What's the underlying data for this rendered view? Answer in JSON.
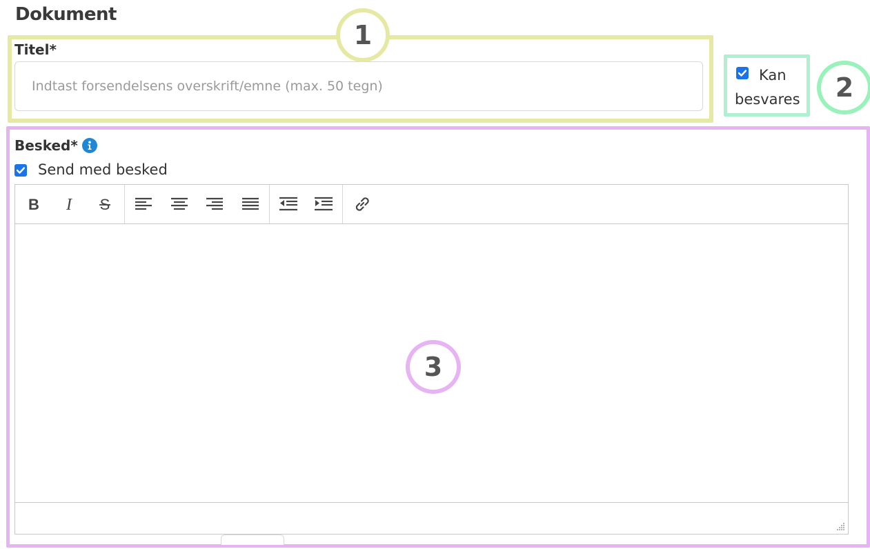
{
  "section": {
    "title": "Dokument"
  },
  "title_field": {
    "label": "Titel*",
    "value": "",
    "placeholder": "Indtast forsendelsens overskrift/emne (max. 50 tegn)"
  },
  "kan_besvares": {
    "label": "Kan besvares",
    "checked": true
  },
  "message": {
    "label": "Besked*",
    "info_icon": "info-icon",
    "send_checkbox": {
      "label": "Send med besked",
      "checked": true
    },
    "toolbar": [
      {
        "group": "format",
        "buttons": [
          "bold",
          "italic",
          "strikethrough"
        ]
      },
      {
        "group": "align",
        "buttons": [
          "align-left",
          "align-center",
          "align-right",
          "justify"
        ]
      },
      {
        "group": "indent",
        "buttons": [
          "outdent",
          "indent"
        ]
      },
      {
        "group": "link",
        "buttons": [
          "link"
        ]
      }
    ],
    "content": ""
  },
  "callouts": {
    "one": "1",
    "two": "2",
    "three": "3"
  },
  "colors": {
    "callout_1": "#e6e9a3",
    "callout_2": "#98f2b9",
    "callout_3": "#e6b3f3",
    "checkbox": "#1a73e8",
    "info": "#1e88d6"
  }
}
